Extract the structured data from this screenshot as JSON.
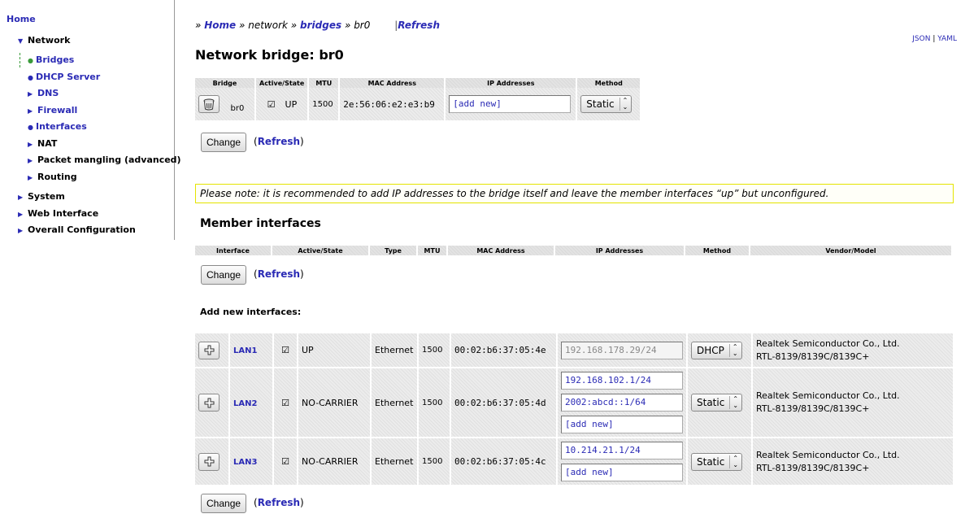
{
  "sidebar": {
    "home": "Home",
    "network": "Network",
    "network_children": [
      "Bridges",
      "DHCP Server",
      "DNS",
      "Firewall",
      "Interfaces",
      "NAT",
      "Packet mangling (advanced)",
      "Routing"
    ],
    "system": "System",
    "web_interface": "Web Interface",
    "overall": "Overall Configuration"
  },
  "breadcrumb": {
    "prefix": "»",
    "home": "Home",
    "network": "network",
    "bridges": "bridges",
    "current": "br0",
    "bar": "|",
    "refresh": "Refresh"
  },
  "format_links": {
    "json": "JSON",
    "sep": "|",
    "yaml": "YAML"
  },
  "page_title": "Network bridge: br0",
  "bridge_table": {
    "headers": [
      "Bridge",
      "Active/State",
      "MTU",
      "MAC Address",
      "IP Addresses",
      "Method"
    ],
    "row": {
      "name": "br0",
      "active": true,
      "state": "UP",
      "mtu": "1500",
      "mac": "2e:56:06:e2:e3:b9",
      "ip_placeholder": "[add new]",
      "method": "Static"
    }
  },
  "change_label": "Change",
  "refresh_label": "Refresh",
  "note": "Please note: it is recommended to add IP addresses to the bridge itself and leave the member interfaces “up” but unconfigured.",
  "member_title": "Member interfaces",
  "member_headers": [
    "Interface",
    "Active/State",
    "Type",
    "MTU",
    "MAC Address",
    "IP Addresses",
    "Method",
    "Vendor/Model"
  ],
  "add_title": "Add new interfaces:",
  "new_interfaces": [
    {
      "name": "LAN1",
      "active": true,
      "state": "UP",
      "type": "Ethernet",
      "mtu": "1500",
      "mac": "00:02:b6:37:05:4e",
      "ips": [
        "192.168.178.29/24"
      ],
      "ip_disabled": true,
      "method": "DHCP",
      "vendor": "Realtek Semiconductor Co., Ltd.",
      "model": "RTL-8139/8139C/8139C+"
    },
    {
      "name": "LAN2",
      "active": true,
      "state": "NO-CARRIER",
      "type": "Ethernet",
      "mtu": "1500",
      "mac": "00:02:b6:37:05:4d",
      "ips": [
        "192.168.102.1/24",
        "2002:abcd::1/64",
        "[add new]"
      ],
      "ip_disabled": false,
      "method": "Static",
      "vendor": "Realtek Semiconductor Co., Ltd.",
      "model": "RTL-8139/8139C/8139C+"
    },
    {
      "name": "LAN3",
      "active": true,
      "state": "NO-CARRIER",
      "type": "Ethernet",
      "mtu": "1500",
      "mac": "00:02:b6:37:05:4c",
      "ips": [
        "10.214.21.1/24",
        "[add new]"
      ],
      "ip_disabled": false,
      "method": "Static",
      "vendor": "Realtek Semiconductor Co., Ltd.",
      "model": "RTL-8139/8139C/8139C+"
    }
  ]
}
